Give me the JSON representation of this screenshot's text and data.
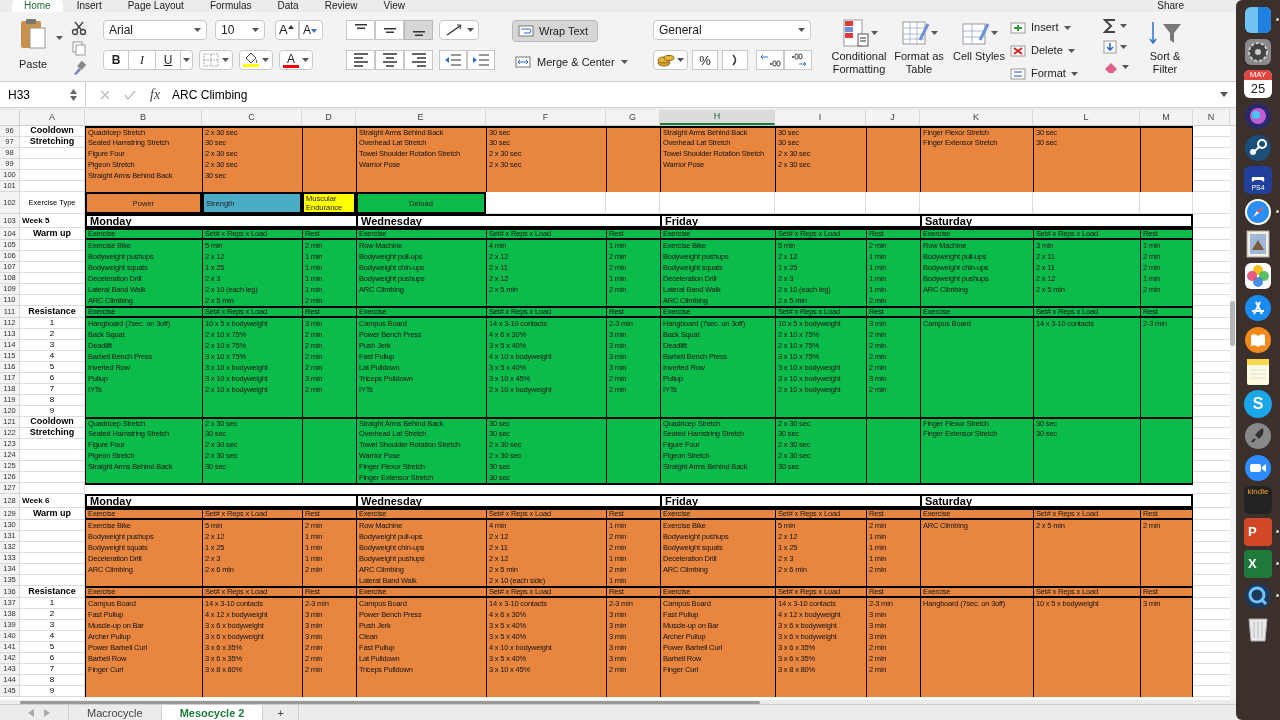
{
  "ribbon_tabs": [
    {
      "label": "Home",
      "selected": true
    },
    {
      "label": "Insert",
      "selected": false
    },
    {
      "label": "Page Layout",
      "selected": false
    },
    {
      "label": "Formulas",
      "selected": false
    },
    {
      "label": "Data",
      "selected": false
    },
    {
      "label": "Review",
      "selected": false
    },
    {
      "label": "View",
      "selected": false
    }
  ],
  "share_label": "Share",
  "clipboard": {
    "paste_label": "Paste"
  },
  "font": {
    "name": "Arial",
    "size": "10",
    "grow_label": "A",
    "shrink_label": "A",
    "bold_label": "B",
    "italic_label": "I",
    "underline_label": "U",
    "font_color_label": "A"
  },
  "alignment": {
    "vertical": [
      {
        "kind": "top",
        "selected": false
      },
      {
        "kind": "middle",
        "selected": false
      },
      {
        "kind": "bottom",
        "selected": true
      }
    ],
    "wrap_text": {
      "label": "Wrap Text",
      "selected": true
    },
    "merge_label": "Merge & Center"
  },
  "number": {
    "format": "General",
    "percent_label": "%"
  },
  "styles": [
    {
      "kind": "conditional",
      "label": "Conditional Formatting"
    },
    {
      "kind": "table",
      "label": "Format as Table"
    },
    {
      "kind": "cell",
      "label": "Cell Styles"
    }
  ],
  "cells_group": [
    {
      "kind": "insert",
      "label": "Insert"
    },
    {
      "kind": "delete",
      "label": "Delete"
    },
    {
      "kind": "format",
      "label": "Format"
    }
  ],
  "editing": {
    "sort_label": "Sort & Filter"
  },
  "formula_bar": {
    "name_box": "H33",
    "fx_label": "fx",
    "formula": "ARC Climbing"
  },
  "columns": [
    {
      "label": "A",
      "selected": false
    },
    {
      "label": "B",
      "selected": false
    },
    {
      "label": "C",
      "selected": false
    },
    {
      "label": "D",
      "selected": false
    },
    {
      "label": "E",
      "selected": false
    },
    {
      "label": "F",
      "selected": false
    },
    {
      "label": "G",
      "selected": false
    },
    {
      "label": "H",
      "selected": true
    },
    {
      "label": "I",
      "selected": false
    },
    {
      "label": "J",
      "selected": false
    },
    {
      "label": "K",
      "selected": false
    },
    {
      "label": "L",
      "selected": false
    },
    {
      "label": "M",
      "selected": false
    },
    {
      "label": "N",
      "selected": false
    }
  ],
  "rows": [
    {
      "number": "96",
      "kind": "band_top",
      "color": "#e8853f",
      "label": {
        "text": "Cooldown",
        "kind": "section"
      },
      "cells": {
        "B": "Quadricep Stretch",
        "C": "2 x 30 sec",
        "E": "Straight Arms Behind Back",
        "F": "30 sec",
        "H": "Straight Arms Behind Back",
        "I": "30 sec",
        "K": "Finger Flexor Stretch",
        "L": "30 sec"
      }
    },
    {
      "number": "97",
      "kind": "band",
      "color": "#e8853f",
      "label": {
        "text": "Stretching",
        "kind": "section"
      },
      "cells": {
        "B": "Seated Hamstring Stretch",
        "C": "30 sec",
        "E": "Overhead Lat Stretch",
        "F": "30 sec",
        "H": "Overhead Lat Stretch",
        "I": "30 sec",
        "K": "Finger Extensor Stretch",
        "L": "30 sec"
      }
    },
    {
      "number": "98",
      "kind": "band",
      "color": "#e8853f",
      "cells": {
        "B": "Figure Four",
        "C": "2 x 30 sec",
        "E": "Towel Shoulder Rotation Stretch",
        "F": "2 x 30 sec",
        "H": "Towel Shoulder Rotation Stretch",
        "I": "2 x 30 sec"
      }
    },
    {
      "number": "99",
      "kind": "band",
      "color": "#e8853f",
      "cells": {
        "B": "Pigeon Stretch",
        "C": "2 x 30 sec",
        "E": "Warrior Pose",
        "F": "2 x 30 sec",
        "H": "Warrior Pose",
        "I": "2 x 30 sec"
      }
    },
    {
      "number": "100",
      "kind": "band",
      "color": "#e8853f",
      "cells": {
        "B": "Straight Arms Behind Back",
        "C": "30 sec"
      }
    },
    {
      "number": "101",
      "kind": "band",
      "color": "#e8853f",
      "cells": {}
    },
    {
      "number": "102",
      "kind": "types",
      "label": {
        "text": "Exercise Type",
        "kind": "plain"
      },
      "cells": {
        "B": {
          "text": "Power",
          "color": "#e8853f"
        },
        "C": {
          "text": "Strength",
          "color": "#4bacc6"
        },
        "D": {
          "text": "Muscular Endurance",
          "color": "#ffff00"
        },
        "E": {
          "text": "Deload",
          "color": "#0cbc4b"
        }
      }
    },
    {
      "number": "103",
      "kind": "days",
      "label": {
        "text": "Week 5",
        "kind": "week"
      },
      "cells": {
        "B": "Monday",
        "E": "Wednesday",
        "H": "Friday",
        "K": "Saturday"
      }
    },
    {
      "number": "104",
      "kind": "col_header",
      "color": "#0cbc4b",
      "label": {
        "text": "Warm up",
        "kind": "section"
      },
      "cells": {
        "B": "Exercise",
        "C": "Set# x Reps x Load",
        "D": "Rest",
        "E": "Exercise",
        "F": "Set# x Reps x Load",
        "G": "Rest",
        "H": "Exercise",
        "I": "Set# x Reps x Load",
        "J": "Rest",
        "K": "Exercise",
        "L": "Set# x Reps x Load",
        "M": "Rest"
      }
    },
    {
      "number": "105",
      "kind": "band",
      "color": "#0cbc4b",
      "cells": {
        "B": "Exercise Bike",
        "C": "5 min",
        "D": "2 min",
        "E": "Row Machine",
        "F": "4 min",
        "G": "1 min",
        "H": "Exercise Bike",
        "I": "5 min",
        "J": "2 min",
        "K": "Row Machine",
        "L": "3 min",
        "M": "1 min"
      }
    },
    {
      "number": "106",
      "kind": "band",
      "color": "#0cbc4b",
      "cells": {
        "B": "Bodyweight pushups",
        "C": "2 x 12",
        "D": "1 min",
        "E": "Bodyweight pull-ups",
        "F": "2 x 12",
        "G": "2 min",
        "H": "Bodyweight pushups",
        "I": "2 x 12",
        "J": "1 min",
        "K": "Bodyweight pull-ups",
        "L": "2 x 11",
        "M": "2 min"
      }
    },
    {
      "number": "107",
      "kind": "band",
      "color": "#0cbc4b",
      "cells": {
        "B": "Bodyweight squats",
        "C": "1 x 25",
        "D": "1 min",
        "E": "Bodyweight chin-ups",
        "F": "2 x 11",
        "G": "2 min",
        "H": "Bodyweight squats",
        "I": "1 x 25",
        "J": "1 min",
        "K": "Bodyweight chin-ups",
        "L": "2 x 11",
        "M": "2 min"
      }
    },
    {
      "number": "108",
      "kind": "band",
      "color": "#0cbc4b",
      "cells": {
        "B": "Deceleration Drill",
        "C": "2 x 3",
        "D": "1 min",
        "E": "Bodyweight pushups",
        "F": "2 x 12",
        "G": "1 min",
        "H": "Deceleration Drill",
        "I": "2 x 3",
        "J": "1 min",
        "K": "Bodyweight pushups",
        "L": "2 x 12",
        "M": "1 min"
      }
    },
    {
      "number": "109",
      "kind": "band",
      "color": "#0cbc4b",
      "cells": {
        "B": "Lateral Band Walk",
        "C": "2 x 10 (each leg)",
        "D": "1 min",
        "E": "ARC Climbing",
        "F": "2 x 5 min",
        "G": "2 min",
        "H": "Lateral Band Walk",
        "I": "2 x 10 (each leg)",
        "J": "1 min",
        "K": "ARC Climbing",
        "L": "2 x 5 min",
        "M": "2 min"
      }
    },
    {
      "number": "110",
      "kind": "band",
      "color": "#0cbc4b",
      "cells": {
        "B": "ARC Climbing",
        "C": "2 x 5 min",
        "D": "2 min",
        "H": "ARC Climbing",
        "I": "2 x 5 min",
        "J": "2 min"
      }
    },
    {
      "number": "111",
      "kind": "col_header",
      "color": "#0cbc4b",
      "label": {
        "text": "Resistance",
        "kind": "section"
      },
      "cells": {
        "B": "Exercise",
        "C": "Set# x Reps x Load",
        "D": "Rest",
        "E": "Exercise",
        "F": "Set# x Reps x Load",
        "G": "Rest",
        "H": "Exercise",
        "I": "Set# x Reps x Load",
        "J": "Rest",
        "K": "Exercise",
        "L": "Set# x Reps x Load",
        "M": "Rest"
      }
    },
    {
      "number": "112",
      "kind": "band",
      "color": "#0cbc4b",
      "label": {
        "text": "1",
        "kind": "number"
      },
      "cells": {
        "B": "Hangboard (7sec. on 3off)",
        "C": "10 x 5 x bodyweight",
        "D": "3 min",
        "E": "Campus Board",
        "F": "14 x 3-10 contacts",
        "G": "2-3 min",
        "H": "Hangboard (7sec. on 3off)",
        "I": "10 x 5 x bodyweight",
        "J": "3 min",
        "K": "Campus Board",
        "L": "14 x 3-10 contacts",
        "M": "2-3 min"
      }
    },
    {
      "number": "113",
      "kind": "band",
      "color": "#0cbc4b",
      "label": {
        "text": "2",
        "kind": "number"
      },
      "cells": {
        "B": "Back Squat",
        "C": "2 x 10 x 75%",
        "D": "2 min",
        "E": "Power Bench Press",
        "F": "4 x 6 x 30%",
        "G": "3 min",
        "H": "Back Squat",
        "I": "2 x 10 x 75%",
        "J": "2 min"
      }
    },
    {
      "number": "114",
      "kind": "band",
      "color": "#0cbc4b",
      "label": {
        "text": "3",
        "kind": "number"
      },
      "cells": {
        "B": "Deadlift",
        "C": "2 x 10 x 75%",
        "D": "2 min",
        "E": "Push Jerk",
        "F": "3 x 5 x 40%",
        "G": "3 min",
        "H": "Deadlift",
        "I": "2 x 10 x 75%",
        "J": "2 min"
      }
    },
    {
      "number": "115",
      "kind": "band",
      "color": "#0cbc4b",
      "label": {
        "text": "4",
        "kind": "number"
      },
      "cells": {
        "B": "Barbell Bench Press",
        "C": "3 x 10 x 75%",
        "D": "2 min",
        "E": "Fast Pullup",
        "F": "4 x 10 x bodyweight",
        "G": "3 min",
        "H": "Barbell Bench Press",
        "I": "3 x 10 x 75%",
        "J": "2 min"
      }
    },
    {
      "number": "116",
      "kind": "band",
      "color": "#0cbc4b",
      "label": {
        "text": "5",
        "kind": "number"
      },
      "cells": {
        "B": "Inverted Row",
        "C": "3 x 10 x bodyweight",
        "D": "2 min",
        "E": "Lat Pulldown",
        "F": "3 x 5 x 40%",
        "G": "3 min",
        "H": "Inverted Row",
        "I": "3 x 10 x bodyweight",
        "J": "2 min"
      }
    },
    {
      "number": "117",
      "kind": "band",
      "color": "#0cbc4b",
      "label": {
        "text": "6",
        "kind": "number"
      },
      "cells": {
        "B": "Pullup",
        "C": "3 x 10 x bodyweight",
        "D": "3 min",
        "E": "Triceps Pulldown",
        "F": "3 x 10 x 45%",
        "G": "2 min",
        "H": "Pullup",
        "I": "3 x 10 x bodyweight",
        "J": "3 min"
      }
    },
    {
      "number": "118",
      "kind": "band",
      "color": "#0cbc4b",
      "label": {
        "text": "7",
        "kind": "number"
      },
      "cells": {
        "B": "IYTs",
        "C": "2 x 10 x bodyweight",
        "D": "2 min",
        "E": "IYTs",
        "F": "2 x 10 x bodyweight",
        "G": "2 min",
        "H": "IYTs",
        "I": "2 x 10 x bodyweight",
        "J": "2 min"
      }
    },
    {
      "number": "119",
      "kind": "band",
      "color": "#0cbc4b",
      "label": {
        "text": "8",
        "kind": "number"
      },
      "cells": {}
    },
    {
      "number": "120",
      "kind": "band",
      "color": "#0cbc4b",
      "label": {
        "text": "9",
        "kind": "number"
      },
      "cells": {}
    },
    {
      "number": "121",
      "kind": "band_top",
      "color": "#0cbc4b",
      "label": {
        "text": "Cooldown",
        "kind": "section"
      },
      "cells": {
        "B": "Quadricep Stretch",
        "C": "2 x 30 sec",
        "E": "Straight Arms Behind Back",
        "F": "30 sec",
        "H": "Quadricep Stretch",
        "I": "2 x 30 sec",
        "K": "Finger Flexor Stretch",
        "L": "30 sec"
      }
    },
    {
      "number": "122",
      "kind": "band",
      "color": "#0cbc4b",
      "label": {
        "text": "Stretching",
        "kind": "section"
      },
      "cells": {
        "B": "Seated Hamstring Stretch",
        "C": "30 sec",
        "E": "Overhead Lat Stretch",
        "F": "30 sec",
        "H": "Seated Hamstring Stretch",
        "I": "30 sec",
        "K": "Finger Extensor Stretch",
        "L": "30 sec"
      }
    },
    {
      "number": "123",
      "kind": "band",
      "color": "#0cbc4b",
      "cells": {
        "B": "Figure Four",
        "C": "2 x 30 sec",
        "E": "Towel Shoulder Rotation Stretch",
        "F": "2 x 30 sec",
        "H": "Figure Four",
        "I": "2 x 30 sec"
      }
    },
    {
      "number": "124",
      "kind": "band",
      "color": "#0cbc4b",
      "cells": {
        "B": "Pigeon Stretch",
        "C": "2 x 30 sec",
        "E": "Warrior Pose",
        "F": "2 x 30 sec",
        "H": "Pigeon Stretch",
        "I": "2 x 30 sec"
      }
    },
    {
      "number": "125",
      "kind": "band",
      "color": "#0cbc4b",
      "cells": {
        "B": "Straight Arms Behind Back",
        "C": "30 sec",
        "E": "Finger Flexor Stretch",
        "F": "30 sec",
        "H": "Straight Arms Behind Back",
        "I": "30 sec"
      }
    },
    {
      "number": "126",
      "kind": "band",
      "color": "#0cbc4b",
      "cells": {
        "E": "Finger Extensor Stretch",
        "F": "30 sec"
      }
    },
    {
      "number": "127",
      "kind": "blank",
      "cells": {}
    },
    {
      "number": "128",
      "kind": "days",
      "label": {
        "text": "Week 6",
        "kind": "week"
      },
      "cells": {
        "B": "Monday",
        "E": "Wednesday",
        "H": "Friday",
        "K": "Saturday"
      }
    },
    {
      "number": "129",
      "kind": "col_header",
      "color": "#e8853f",
      "label": {
        "text": "Warm up",
        "kind": "section"
      },
      "cells": {
        "B": "Exercise",
        "C": "Set# x Reps x Load",
        "D": "Rest",
        "E": "Exercise",
        "F": "Set# x Reps x Load",
        "G": "Rest",
        "H": "Exercise",
        "I": "Set# x Reps x Load",
        "J": "Rest",
        "K": "Exercise",
        "L": "Set# x Reps x Load",
        "M": "Rest"
      }
    },
    {
      "number": "130",
      "kind": "band",
      "color": "#e8853f",
      "cells": {
        "B": "Exercise Bike",
        "C": "5 min",
        "D": "2 min",
        "E": "Row Machine",
        "F": "4 min",
        "G": "1 min",
        "H": "Exercise Bike",
        "I": "5 min",
        "J": "2 min",
        "K": "ARC Climbing",
        "L": "2 x 5 min",
        "M": "2 min"
      }
    },
    {
      "number": "131",
      "kind": "band",
      "color": "#e8853f",
      "cells": {
        "B": "Bodyweight pushups",
        "C": "2 x 12",
        "D": "1 min",
        "E": "Bodyweight pull-ups",
        "F": "2 x 12",
        "G": "2 min",
        "H": "Bodyweight pushups",
        "I": "2 x 12",
        "J": "1 min"
      }
    },
    {
      "number": "132",
      "kind": "band",
      "color": "#e8853f",
      "cells": {
        "B": "Bodyweight squats",
        "C": "1 x 25",
        "D": "1 min",
        "E": "Bodyweight chin-ups",
        "F": "2 x 11",
        "G": "2 min",
        "H": "Bodyweight squats",
        "I": "1 x 25",
        "J": "1 min"
      }
    },
    {
      "number": "133",
      "kind": "band",
      "color": "#e8853f",
      "cells": {
        "B": "Deceleration Drill",
        "C": "2 x 3",
        "D": "1 min",
        "E": "Bodyweight pushups",
        "F": "2 x 12",
        "G": "1 min",
        "H": "Deceleration Drill",
        "I": "2 x 3",
        "J": "1 min"
      }
    },
    {
      "number": "134",
      "kind": "band",
      "color": "#e8853f",
      "cells": {
        "B": "ARC Climbing",
        "C": "2 x 6 min",
        "D": "2 min",
        "E": "ARC Climbing",
        "F": "2 x 5 min",
        "G": "2 min",
        "H": "ARC Climbing",
        "I": "2 x 6 min",
        "J": "2 min"
      }
    },
    {
      "number": "135",
      "kind": "band",
      "color": "#e8853f",
      "cells": {
        "E": "Lateral Band Walk",
        "F": "2 x 10 (each side)",
        "G": "1 min"
      }
    },
    {
      "number": "136",
      "kind": "col_header",
      "color": "#e8853f",
      "label": {
        "text": "Resistance",
        "kind": "section"
      },
      "cells": {
        "B": "Exercise",
        "C": "Set# x Reps x Load",
        "D": "Rest",
        "E": "Exercise",
        "F": "Set# x Reps x Load",
        "G": "Rest",
        "H": "Exercise",
        "I": "Set# x Reps x Load",
        "J": "Rest",
        "K": "Exercise",
        "L": "Set# x Reps x Load",
        "M": "Rest"
      }
    },
    {
      "number": "137",
      "kind": "band",
      "color": "#e8853f",
      "label": {
        "text": "1",
        "kind": "number"
      },
      "cells": {
        "B": "Campus Board",
        "C": "14 x 3-10 contacts",
        "D": "2-3 min",
        "E": "Campus Board",
        "F": "14 x 3-10 contacts",
        "G": "2-3 min",
        "H": "Campus Board",
        "I": "14 x 3-10 contacts",
        "J": "2-3 min",
        "K": "Hangboard (7sec. on 3off)",
        "L": "10 x 5 x bodyweight",
        "M": "3 min"
      }
    },
    {
      "number": "138",
      "kind": "band",
      "color": "#e8853f",
      "label": {
        "text": "2",
        "kind": "number"
      },
      "cells": {
        "B": "Fast Pullup",
        "C": "4 x 12 x bodyweight",
        "D": "3 min",
        "E": "Power Bench Press",
        "F": "4 x 6 x 30%",
        "G": "3 min",
        "H": "Fast Pullup",
        "I": "4 x 12 x bodyweight",
        "J": "3 min"
      }
    },
    {
      "number": "139",
      "kind": "band",
      "color": "#e8853f",
      "label": {
        "text": "3",
        "kind": "number"
      },
      "cells": {
        "B": "Muscle-up on Bar",
        "C": "3 x 6 x bodyweight",
        "D": "3 min",
        "E": "Push Jerk",
        "F": "3 x 5 x 40%",
        "G": "3 min",
        "H": "Muscle-up on Bar",
        "I": "3 x 6 x bodyweight",
        "J": "3 min"
      }
    },
    {
      "number": "140",
      "kind": "band",
      "color": "#e8853f",
      "label": {
        "text": "4",
        "kind": "number"
      },
      "cells": {
        "B": "Archer Pullup",
        "C": "3 x 6 x bodyweight",
        "D": "3 min",
        "E": "Clean",
        "F": "3 x 5 x 40%",
        "G": "3 min",
        "H": "Archer Pullup",
        "I": "3 x 6 x bodyweight",
        "J": "3 min"
      }
    },
    {
      "number": "141",
      "kind": "band",
      "color": "#e8853f",
      "label": {
        "text": "5",
        "kind": "number"
      },
      "cells": {
        "B": "Power Barbell Curl",
        "C": "3 x 6 x 35%",
        "D": "2 min",
        "E": "Fast Pullup",
        "F": "4 x 10 x bodyweight",
        "G": "3 min",
        "H": "Power Barbell Curl",
        "I": "3 x 6 x 35%",
        "J": "2 min"
      }
    },
    {
      "number": "142",
      "kind": "band",
      "color": "#e8853f",
      "label": {
        "text": "6",
        "kind": "number"
      },
      "cells": {
        "B": "Barbell Row",
        "C": "3 x 6 x 35%",
        "D": "2 min",
        "E": "Lat Pulldown",
        "F": "3 x 5 x 40%",
        "G": "3 min",
        "H": "Barbell Row",
        "I": "3 x 6 x 35%",
        "J": "2 min"
      }
    },
    {
      "number": "143",
      "kind": "band",
      "color": "#e8853f",
      "label": {
        "text": "7",
        "kind": "number"
      },
      "cells": {
        "B": "Finger Curl",
        "C": "3 x 8 x 80%",
        "D": "2 min",
        "E": "Triceps Pulldown",
        "F": "3 x 10 x 45%",
        "G": "2 min",
        "H": "Finger Curl",
        "I": "3 x 8 x 80%",
        "J": "2 min"
      }
    },
    {
      "number": "144",
      "kind": "band",
      "color": "#e8853f",
      "label": {
        "text": "8",
        "kind": "number"
      },
      "cells": {}
    },
    {
      "number": "145",
      "kind": "band",
      "color": "#e8853f",
      "label": {
        "text": "9",
        "kind": "number"
      },
      "cells": {}
    }
  ],
  "sheet_tabs": [
    {
      "label": "Macrocycle",
      "selected": false
    },
    {
      "label": "Mesocycle 2",
      "selected": true
    }
  ],
  "add_sheet_label": "+",
  "dock": [
    {
      "kind": "finder",
      "running": true
    },
    {
      "kind": "settings",
      "running": false
    },
    {
      "kind": "calendar",
      "running": false,
      "text": "MAY",
      "subtext": "25"
    },
    {
      "kind": "siri",
      "running": false
    },
    {
      "kind": "steam",
      "running": false
    },
    {
      "kind": "ps4",
      "running": false,
      "text": "PS4"
    },
    {
      "kind": "safari",
      "running": true
    },
    {
      "kind": "mail",
      "running": false
    },
    {
      "kind": "photos",
      "running": false
    },
    {
      "kind": "appstore",
      "running": false
    },
    {
      "kind": "books",
      "running": false
    },
    {
      "kind": "notes",
      "running": false
    },
    {
      "kind": "skype",
      "running": false,
      "text": "S"
    },
    {
      "kind": "launchpad",
      "running": false
    },
    {
      "kind": "zoom",
      "running": false
    },
    {
      "kind": "kindle",
      "running": false,
      "text": "kindle"
    },
    {
      "kind": "powerpoint",
      "running": true,
      "text": "P"
    },
    {
      "kind": "excel",
      "running": true,
      "text": "X"
    },
    {
      "kind": "quicktime",
      "running": true
    },
    {
      "kind": "trash",
      "running": false
    }
  ]
}
